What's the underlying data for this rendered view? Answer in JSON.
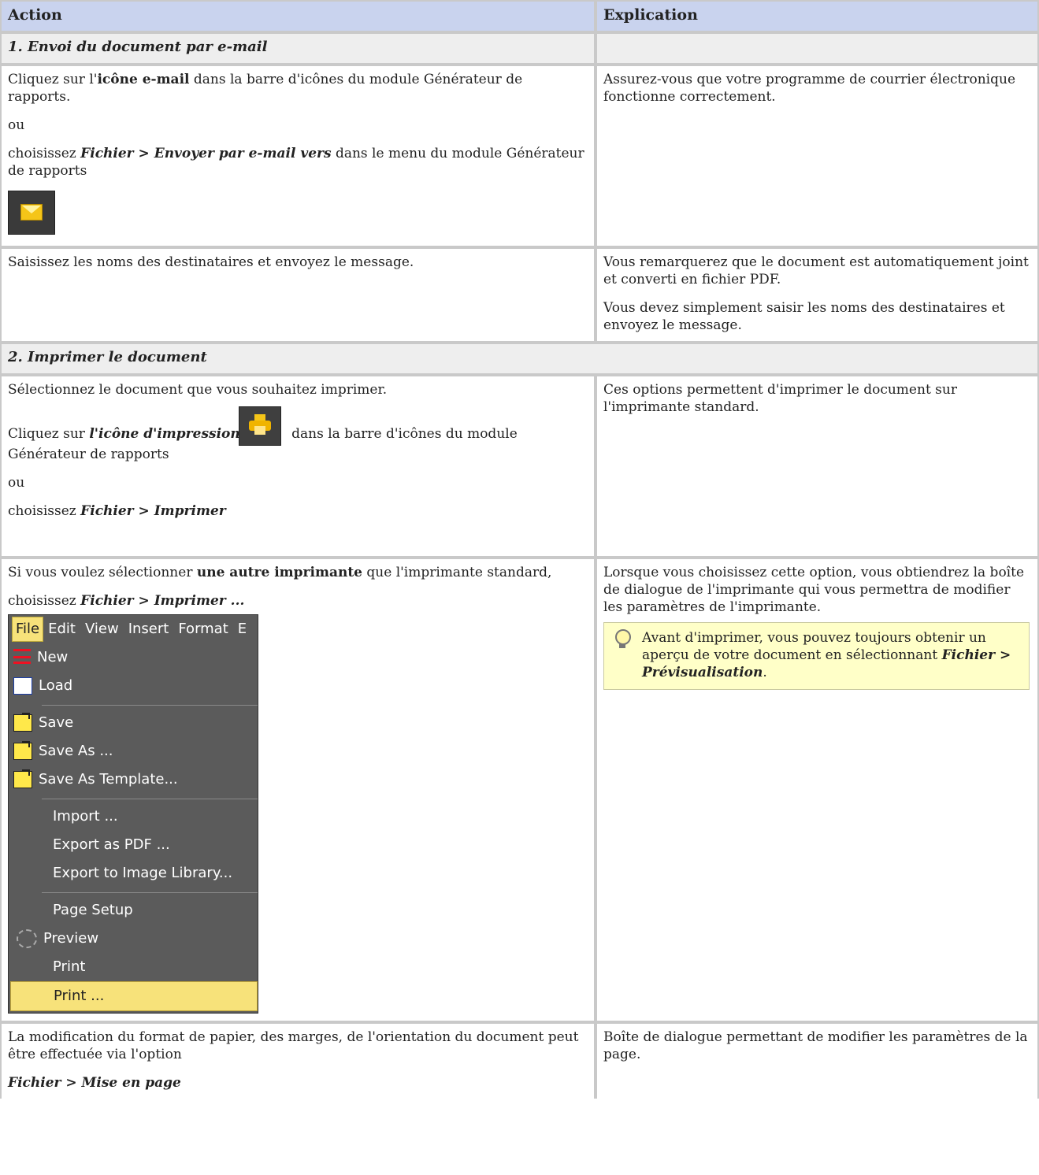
{
  "table": {
    "head": {
      "action": "Action",
      "explanation": "Explication"
    },
    "section1": "1. Envoi du document par e-mail",
    "row1": {
      "a_p1_pre": "Cliquez sur l'",
      "a_p1_bold": "icône e-mail",
      "a_p1_post": " dans la barre d'icônes du module Générateur de rapports.",
      "a_or": "ou",
      "a_p3_pre": "choisissez ",
      "a_p3_bi1": "Fichier",
      "a_p3_gt": " > ",
      "a_p3_bi2": "Envoyer par e-mail vers",
      "a_p3_post": " dans le menu du module Générateur de rapports",
      "e_p1": "Assurez-vous que votre programme de courrier électronique fonctionne correctement."
    },
    "row2": {
      "a_p1": "Saisissez les noms des destinataires et envoyez le message.",
      "e_p1": "Vous remarquerez que le document est automatiquement joint et converti en fichier PDF.",
      "e_p2": "Vous devez simplement saisir les noms des destinataires et envoyez le message."
    },
    "section2": "2. Imprimer le document",
    "row3": {
      "a_p1": "Sélectionnez le document que vous souhaitez imprimer.",
      "a_p2_pre": "Cliquez sur ",
      "a_p2_bi": "l'icône d'impression",
      "a_p2_post": " dans la barre d'icônes du module Générateur de rapports",
      "a_or": "ou",
      "a_p4_pre": "choisissez ",
      "a_p4_bi1": "Fichier",
      "a_p4_gt": " > ",
      "a_p4_bi2": "Imprimer",
      "e_p1": "Ces options permettent d'imprimer le document sur l'imprimante standard."
    },
    "row4": {
      "a_p1_pre": "Si vous voulez sélectionner ",
      "a_p1_bold": "une autre imprimante",
      "a_p1_post": " que l'imprimante standard,",
      "a_p2_pre": "choisissez ",
      "a_p2_bi1": "Fichier",
      "a_p2_gt": " > ",
      "a_p2_bi2": "Imprimer ...",
      "e_p1": "Lorsque vous choisissez cette option, vous obtiendrez la boîte de dialogue de l'imprimante qui vous permettra de modifier les paramètres de l'imprimante.",
      "tip_pre": "Avant d'imprimer, vous pouvez toujours obtenir un aperçu de votre document en sélectionnant ",
      "tip_bi1": "Fichier",
      "tip_gt": " > ",
      "tip_bi2": "Prévisualisation",
      "tip_post": "."
    },
    "row5": {
      "a_p1": "La modification du format de papier, des marges, de l'orientation du document peut être effectuée via l'option",
      "a_p2_bi": "Fichier > Mise en page",
      "e_p1": "Boîte de dialogue permettant de modifier les paramètres de la page."
    }
  },
  "menu": {
    "bar": [
      "File",
      "Edit",
      "View",
      "Insert",
      "Format",
      "E"
    ],
    "items": [
      {
        "label": "New",
        "icon": "new-icon"
      },
      {
        "label": "Load",
        "icon": "load-icon"
      },
      {
        "label": "Save",
        "icon": "save-icon"
      },
      {
        "label": "Save As ...",
        "icon": "save-icon"
      },
      {
        "label": "Save As Template...",
        "icon": "save-icon"
      },
      {
        "label": "Import ..."
      },
      {
        "label": "Export as PDF ..."
      },
      {
        "label": "Export to Image Library..."
      },
      {
        "label": "Page Setup"
      },
      {
        "label": "Preview",
        "icon": "preview-icon"
      },
      {
        "label": "Print"
      },
      {
        "label": "Print ...",
        "selected": true
      }
    ]
  }
}
